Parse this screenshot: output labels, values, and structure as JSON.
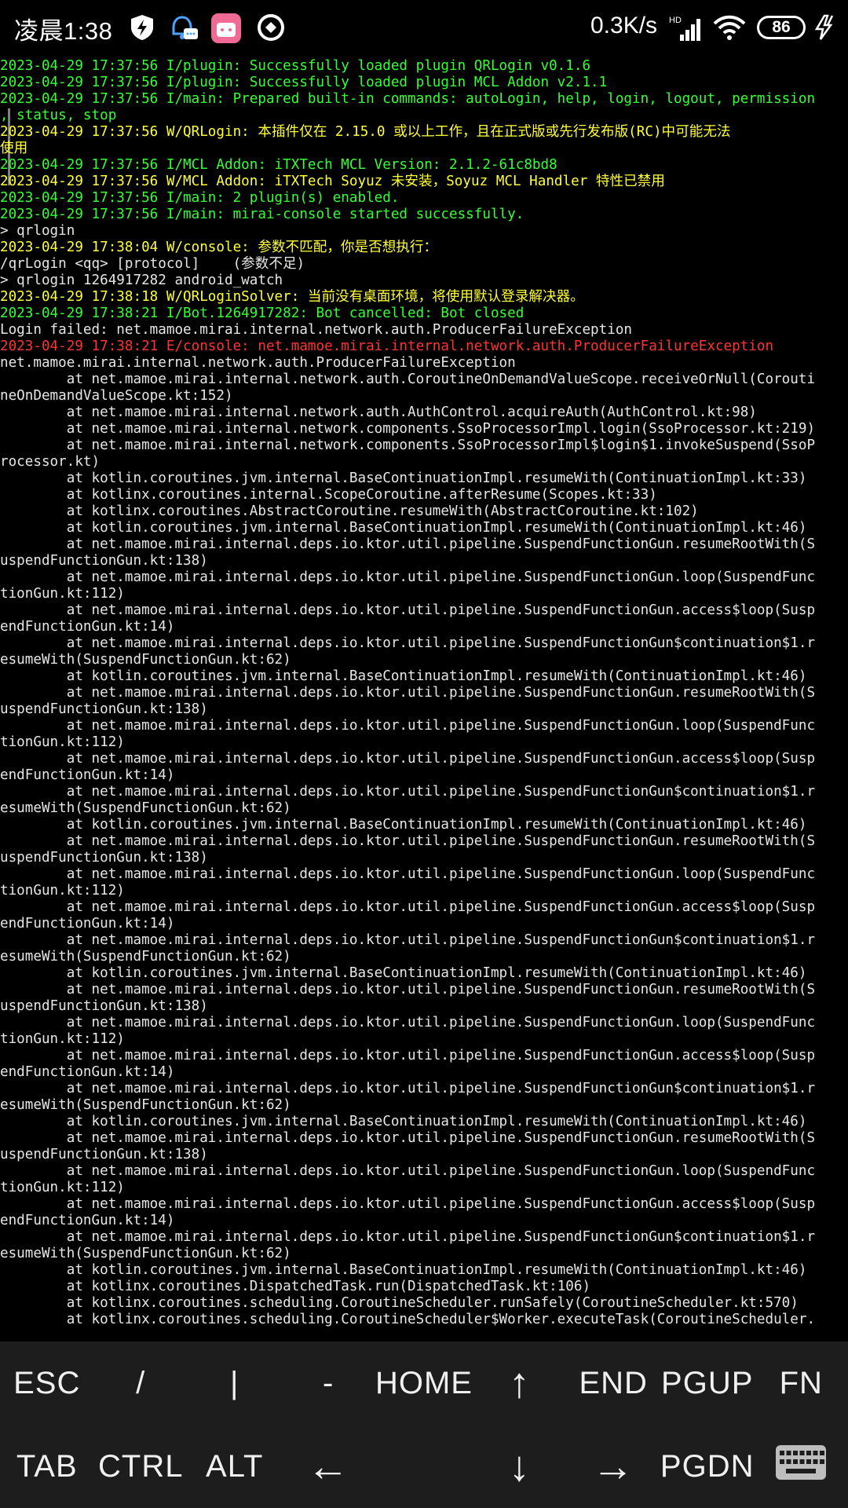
{
  "status_bar": {
    "time": "凌晨1:38",
    "net_speed": "0.3K/s",
    "net_badge": "HD",
    "battery": "86",
    "app_icons": [
      "shield-bolt-icon",
      "qq-bell-icon",
      "bilibili-icon",
      "music-disc-icon"
    ]
  },
  "colors": {
    "info": "#33ff33",
    "warn": "#ffff33",
    "error": "#ff3333",
    "plain": "#e6e6e6",
    "keyboard_bg": "#1d1d1d"
  },
  "terminal": {
    "lines": [
      {
        "t": "2023-04-29 17:37:56 I/plugin: Successfully loaded plugin QRLogin v0.1.6",
        "c": "info"
      },
      {
        "t": "2023-04-29 17:37:56 I/plugin: Successfully loaded plugin MCL Addon v2.1.1",
        "c": "info"
      },
      {
        "t": "2023-04-29 17:37:56 I/main: Prepared built-in commands: autoLogin, help, login, logout, permission",
        "c": "info"
      },
      {
        "t": ", status, stop",
        "c": "info"
      },
      {
        "t": "2023-04-29 17:37:56 W/QRLogin: 本插件仅在 2.15.0 或以上工作，且在正式版或先行发布版(RC)中可能无法",
        "c": "warn"
      },
      {
        "t": "使用",
        "c": "warn"
      },
      {
        "t": "2023-04-29 17:37:56 I/MCL Addon: iTXTech MCL Version: 2.1.2-61c8bd8",
        "c": "info"
      },
      {
        "t": "2023-04-29 17:37:56 W/MCL Addon: iTXTech Soyuz 未安装，Soyuz MCL Handler 特性已禁用",
        "c": "warn"
      },
      {
        "t": "2023-04-29 17:37:56 I/main: 2 plugin(s) enabled.",
        "c": "info"
      },
      {
        "t": "2023-04-29 17:37:56 I/main: mirai-console started successfully.",
        "c": "info"
      },
      {
        "t": "> qrlogin",
        "c": "plain"
      },
      {
        "t": "2023-04-29 17:38:04 W/console: 参数不匹配，你是否想执行：",
        "c": "warn"
      },
      {
        "t": "/qrLogin <qq> [protocol]    (参数不足)",
        "c": "plain"
      },
      {
        "t": "> qrlogin 1264917282 android_watch",
        "c": "plain"
      },
      {
        "t": "2023-04-29 17:38:18 W/QRLoginSolver: 当前没有桌面环境，将使用默认登录解决器。",
        "c": "warn"
      },
      {
        "t": "2023-04-29 17:38:21 I/Bot.1264917282: Bot cancelled: Bot closed",
        "c": "info"
      },
      {
        "t": "Login failed: net.mamoe.mirai.internal.network.auth.ProducerFailureException",
        "c": "plain"
      },
      {
        "t": "2023-04-29 17:38:21 E/console: net.mamoe.mirai.internal.network.auth.ProducerFailureException",
        "c": "err"
      },
      {
        "t": "net.mamoe.mirai.internal.network.auth.ProducerFailureException",
        "c": "plain"
      },
      {
        "t": "        at net.mamoe.mirai.internal.network.auth.CoroutineOnDemandValueScope.receiveOrNull(Corouti",
        "c": "plain"
      },
      {
        "t": "neOnDemandValueScope.kt:152)",
        "c": "plain"
      },
      {
        "t": "        at net.mamoe.mirai.internal.network.auth.AuthControl.acquireAuth(AuthControl.kt:98)",
        "c": "plain"
      },
      {
        "t": "        at net.mamoe.mirai.internal.network.components.SsoProcessorImpl.login(SsoProcessor.kt:219)",
        "c": "plain"
      },
      {
        "t": "        at net.mamoe.mirai.internal.network.components.SsoProcessorImpl$login$1.invokeSuspend(SsoP",
        "c": "plain"
      },
      {
        "t": "rocessor.kt)",
        "c": "plain"
      },
      {
        "t": "        at kotlin.coroutines.jvm.internal.BaseContinuationImpl.resumeWith(ContinuationImpl.kt:33)",
        "c": "plain"
      },
      {
        "t": "        at kotlinx.coroutines.internal.ScopeCoroutine.afterResume(Scopes.kt:33)",
        "c": "plain"
      },
      {
        "t": "        at kotlinx.coroutines.AbstractCoroutine.resumeWith(AbstractCoroutine.kt:102)",
        "c": "plain"
      },
      {
        "t": "        at kotlin.coroutines.jvm.internal.BaseContinuationImpl.resumeWith(ContinuationImpl.kt:46)",
        "c": "plain"
      },
      {
        "t": "        at net.mamoe.mirai.internal.deps.io.ktor.util.pipeline.SuspendFunctionGun.resumeRootWith(S",
        "c": "plain"
      },
      {
        "t": "uspendFunctionGun.kt:138)",
        "c": "plain"
      },
      {
        "t": "        at net.mamoe.mirai.internal.deps.io.ktor.util.pipeline.SuspendFunctionGun.loop(SuspendFunc",
        "c": "plain"
      },
      {
        "t": "tionGun.kt:112)",
        "c": "plain"
      },
      {
        "t": "        at net.mamoe.mirai.internal.deps.io.ktor.util.pipeline.SuspendFunctionGun.access$loop(Susp",
        "c": "plain"
      },
      {
        "t": "endFunctionGun.kt:14)",
        "c": "plain"
      },
      {
        "t": "        at net.mamoe.mirai.internal.deps.io.ktor.util.pipeline.SuspendFunctionGun$continuation$1.r",
        "c": "plain"
      },
      {
        "t": "esumeWith(SuspendFunctionGun.kt:62)",
        "c": "plain"
      },
      {
        "t": "        at kotlin.coroutines.jvm.internal.BaseContinuationImpl.resumeWith(ContinuationImpl.kt:46)",
        "c": "plain"
      },
      {
        "t": "        at net.mamoe.mirai.internal.deps.io.ktor.util.pipeline.SuspendFunctionGun.resumeRootWith(S",
        "c": "plain"
      },
      {
        "t": "uspendFunctionGun.kt:138)",
        "c": "plain"
      },
      {
        "t": "        at net.mamoe.mirai.internal.deps.io.ktor.util.pipeline.SuspendFunctionGun.loop(SuspendFunc",
        "c": "plain"
      },
      {
        "t": "tionGun.kt:112)",
        "c": "plain"
      },
      {
        "t": "        at net.mamoe.mirai.internal.deps.io.ktor.util.pipeline.SuspendFunctionGun.access$loop(Susp",
        "c": "plain"
      },
      {
        "t": "endFunctionGun.kt:14)",
        "c": "plain"
      },
      {
        "t": "        at net.mamoe.mirai.internal.deps.io.ktor.util.pipeline.SuspendFunctionGun$continuation$1.r",
        "c": "plain"
      },
      {
        "t": "esumeWith(SuspendFunctionGun.kt:62)",
        "c": "plain"
      },
      {
        "t": "        at kotlin.coroutines.jvm.internal.BaseContinuationImpl.resumeWith(ContinuationImpl.kt:46)",
        "c": "plain"
      },
      {
        "t": "        at net.mamoe.mirai.internal.deps.io.ktor.util.pipeline.SuspendFunctionGun.resumeRootWith(S",
        "c": "plain"
      },
      {
        "t": "uspendFunctionGun.kt:138)",
        "c": "plain"
      },
      {
        "t": "        at net.mamoe.mirai.internal.deps.io.ktor.util.pipeline.SuspendFunctionGun.loop(SuspendFunc",
        "c": "plain"
      },
      {
        "t": "tionGun.kt:112)",
        "c": "plain"
      },
      {
        "t": "        at net.mamoe.mirai.internal.deps.io.ktor.util.pipeline.SuspendFunctionGun.access$loop(Susp",
        "c": "plain"
      },
      {
        "t": "endFunctionGun.kt:14)",
        "c": "plain"
      },
      {
        "t": "        at net.mamoe.mirai.internal.deps.io.ktor.util.pipeline.SuspendFunctionGun$continuation$1.r",
        "c": "plain"
      },
      {
        "t": "esumeWith(SuspendFunctionGun.kt:62)",
        "c": "plain"
      },
      {
        "t": "        at kotlin.coroutines.jvm.internal.BaseContinuationImpl.resumeWith(ContinuationImpl.kt:46)",
        "c": "plain"
      },
      {
        "t": "        at net.mamoe.mirai.internal.deps.io.ktor.util.pipeline.SuspendFunctionGun.resumeRootWith(S",
        "c": "plain"
      },
      {
        "t": "uspendFunctionGun.kt:138)",
        "c": "plain"
      },
      {
        "t": "        at net.mamoe.mirai.internal.deps.io.ktor.util.pipeline.SuspendFunctionGun.loop(SuspendFunc",
        "c": "plain"
      },
      {
        "t": "tionGun.kt:112)",
        "c": "plain"
      },
      {
        "t": "        at net.mamoe.mirai.internal.deps.io.ktor.util.pipeline.SuspendFunctionGun.access$loop(Susp",
        "c": "plain"
      },
      {
        "t": "endFunctionGun.kt:14)",
        "c": "plain"
      },
      {
        "t": "        at net.mamoe.mirai.internal.deps.io.ktor.util.pipeline.SuspendFunctionGun$continuation$1.r",
        "c": "plain"
      },
      {
        "t": "esumeWith(SuspendFunctionGun.kt:62)",
        "c": "plain"
      },
      {
        "t": "        at kotlin.coroutines.jvm.internal.BaseContinuationImpl.resumeWith(ContinuationImpl.kt:46)",
        "c": "plain"
      },
      {
        "t": "        at net.mamoe.mirai.internal.deps.io.ktor.util.pipeline.SuspendFunctionGun.resumeRootWith(S",
        "c": "plain"
      },
      {
        "t": "uspendFunctionGun.kt:138)",
        "c": "plain"
      },
      {
        "t": "        at net.mamoe.mirai.internal.deps.io.ktor.util.pipeline.SuspendFunctionGun.loop(SuspendFunc",
        "c": "plain"
      },
      {
        "t": "tionGun.kt:112)",
        "c": "plain"
      },
      {
        "t": "        at net.mamoe.mirai.internal.deps.io.ktor.util.pipeline.SuspendFunctionGun.access$loop(Susp",
        "c": "plain"
      },
      {
        "t": "endFunctionGun.kt:14)",
        "c": "plain"
      },
      {
        "t": "        at net.mamoe.mirai.internal.deps.io.ktor.util.pipeline.SuspendFunctionGun$continuation$1.r",
        "c": "plain"
      },
      {
        "t": "esumeWith(SuspendFunctionGun.kt:62)",
        "c": "plain"
      },
      {
        "t": "        at kotlin.coroutines.jvm.internal.BaseContinuationImpl.resumeWith(ContinuationImpl.kt:46)",
        "c": "plain"
      },
      {
        "t": "        at kotlinx.coroutines.DispatchedTask.run(DispatchedTask.kt:106)",
        "c": "plain"
      },
      {
        "t": "        at kotlinx.coroutines.scheduling.CoroutineScheduler.runSafely(CoroutineScheduler.kt:570)",
        "c": "plain"
      },
      {
        "t": "        at kotlinx.coroutines.scheduling.CoroutineScheduler$Worker.executeTask(CoroutineScheduler.",
        "c": "plain"
      }
    ]
  },
  "extra_keys": {
    "row1": [
      {
        "name": "key-esc",
        "label": "ESC"
      },
      {
        "name": "key-slash",
        "label": "/"
      },
      {
        "name": "key-pipe",
        "label": "|"
      },
      {
        "name": "key-dash",
        "label": "-"
      },
      {
        "name": "key-home",
        "label": "HOME"
      },
      {
        "name": "key-up",
        "label": "↑"
      },
      {
        "name": "key-end",
        "label": "END"
      },
      {
        "name": "key-pgup",
        "label": "PGUP"
      },
      {
        "name": "key-fn",
        "label": "FN"
      }
    ],
    "row2": [
      {
        "name": "key-tab",
        "label": "TAB"
      },
      {
        "name": "key-ctrl",
        "label": "CTRL"
      },
      {
        "name": "key-alt",
        "label": "ALT"
      },
      {
        "name": "key-left",
        "label": "←"
      },
      {
        "name": "key-down",
        "label": "↓"
      },
      {
        "name": "key-right",
        "label": "→"
      },
      {
        "name": "key-pgdn",
        "label": "PGDN"
      },
      {
        "name": "key-keyboard",
        "label": "",
        "icon": "keyboard-icon"
      }
    ]
  }
}
